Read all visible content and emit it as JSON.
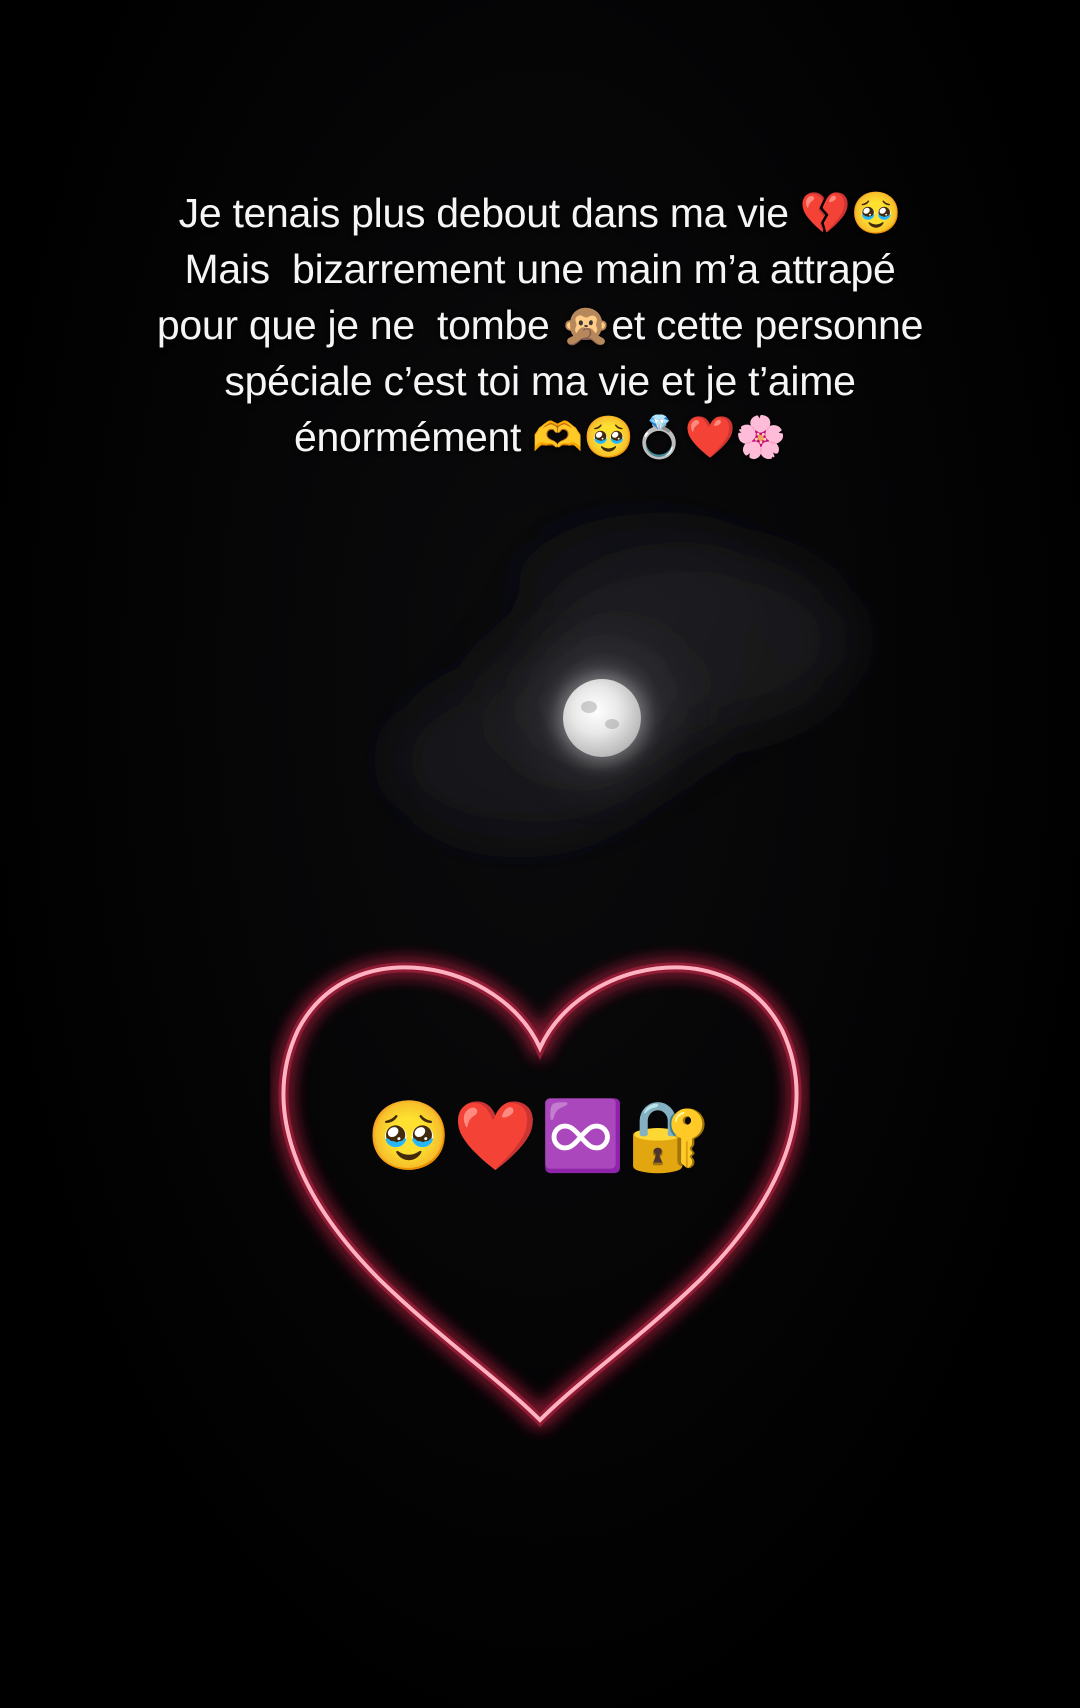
{
  "caption": {
    "lines": [
      "Je tenais plus debout dans ma vie 💔🥹",
      "Mais  bizarrement une main m’a attrapé",
      "pour que je ne  tombe 🙊et cette personne",
      "spéciale c’est toi ma vie et je t’aime",
      "énormément 🫶🥹💍❤️🌸"
    ]
  },
  "heart_center": {
    "emojis": [
      "🥹",
      "❤️",
      "♾️",
      "🔐"
    ]
  },
  "colors": {
    "background": "#000000",
    "text": "#f5f5f5",
    "neon_heart": "#ff6f8a",
    "neon_glow": "#ff2d5a"
  }
}
